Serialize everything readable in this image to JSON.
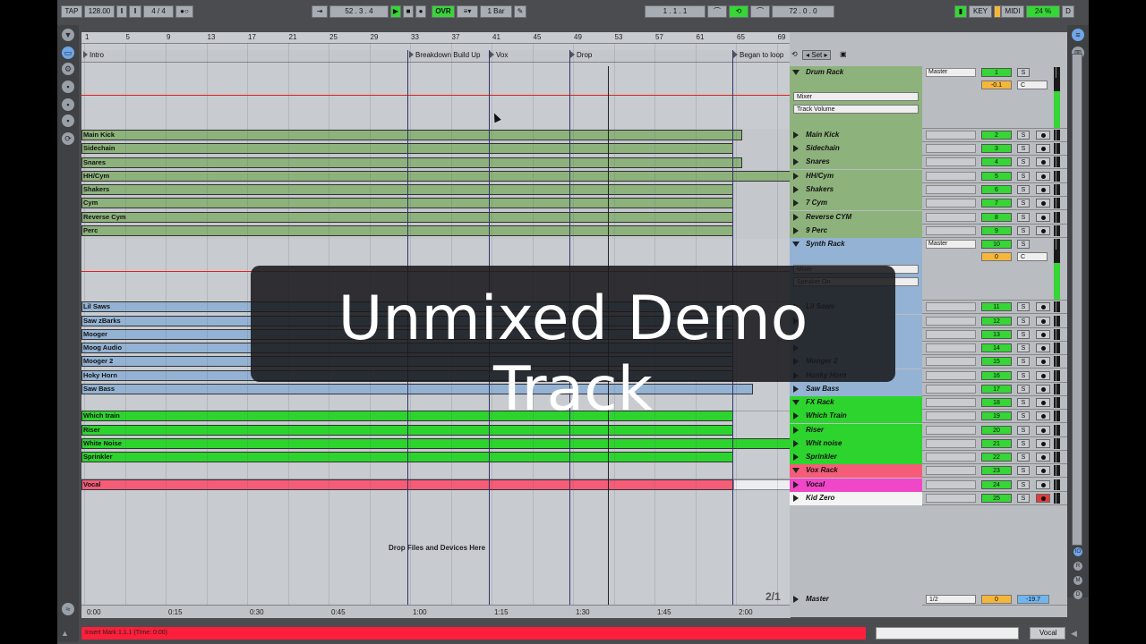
{
  "transport": {
    "tap": "TAP",
    "tempo": "128.00",
    "time_sig": "4 / 4",
    "position": "52 . 3 . 4",
    "ovr": "OVR",
    "quantize": "1 Bar",
    "loop_start": "1 . 1 . 1",
    "loop_length": "72 . 0 . 0",
    "key": "KEY",
    "midi": "MIDI",
    "cpu": "24 %",
    "d": "D"
  },
  "ruler": [
    "1",
    "5",
    "9",
    "13",
    "17",
    "21",
    "25",
    "29",
    "33",
    "37",
    "41",
    "45",
    "49",
    "53",
    "57",
    "61",
    "65",
    "69"
  ],
  "locators": [
    "Intro",
    "Breakdown Build Up",
    "Vox",
    "Drop",
    "Began to loop"
  ],
  "lane_clips": {
    "drums": [
      "Main Kick",
      "Sidechain",
      "Snares",
      "HH/Cym",
      "Shakers",
      "Cym",
      "Reverse Cym",
      "Perc"
    ],
    "synths": [
      "Lil Saws",
      "Saw zBarks",
      "Mooger",
      "Moog Audio",
      "Mooger 2",
      "Hoky Horn",
      "Saw Bass"
    ],
    "fx": [
      "Which train",
      "Riser",
      "White Noise",
      "Sprinkler"
    ],
    "vox": [
      "Vocal"
    ]
  },
  "drop_text": "Drop Files and Devices Here",
  "time_ruler": [
    "0:00",
    "0:15",
    "0:30",
    "0:45",
    "1:00",
    "1:15",
    "1:30",
    "1:45",
    "2:00"
  ],
  "position_indicator": "2/1",
  "tracks": [
    {
      "name": "Drum Rack",
      "num": "1",
      "group": true,
      "io": "Master"
    },
    {
      "name": "Main Kick",
      "num": "2"
    },
    {
      "name": "Sidechain",
      "num": "3"
    },
    {
      "name": "Snares",
      "num": "4"
    },
    {
      "name": "HH/Cym",
      "num": "5"
    },
    {
      "name": "Shakers",
      "num": "6"
    },
    {
      "name": "7 Cym",
      "num": "7"
    },
    {
      "name": "Reverse CYM",
      "num": "8"
    },
    {
      "name": "9 Perc",
      "num": "9"
    },
    {
      "name": "Synth Rack",
      "num": "10",
      "group": true,
      "io": "Master"
    },
    {
      "name": "Lil Saws",
      "num": "11"
    },
    {
      "name": "",
      "num": "12"
    },
    {
      "name": "",
      "num": "13"
    },
    {
      "name": "",
      "num": "14"
    },
    {
      "name": "Mooger 2",
      "num": "15"
    },
    {
      "name": "Honky Horn",
      "num": "16"
    },
    {
      "name": "Saw Bass",
      "num": "17"
    },
    {
      "name": "FX Rack",
      "num": "18"
    },
    {
      "name": "Which Train",
      "num": "19"
    },
    {
      "name": "Riser",
      "num": "20"
    },
    {
      "name": "Whit noise",
      "num": "21"
    },
    {
      "name": "Sprinkler",
      "num": "22"
    },
    {
      "name": "Vox Rack",
      "num": "23"
    },
    {
      "name": "Vocal",
      "num": "24"
    },
    {
      "name": "Kid Zero",
      "num": "25"
    }
  ],
  "drum_rack": {
    "mixer": "Mixer",
    "param": "Track Volume",
    "pan": "-0.1",
    "pan_right": "C"
  },
  "synth_rack": {
    "mixer": "Mixer",
    "param": "Speaker On",
    "pan": "0",
    "pan_right": "C"
  },
  "master": {
    "name": "Master",
    "io": "1/2",
    "pan": "0",
    "vol": "-19.7"
  },
  "solo": "S",
  "status": "Insert Mark 1.1.1 (Time: 0:00)",
  "bottom_track": "Vocal",
  "overlay_title": "Unmixed Demo Track",
  "colors": {
    "drum": "#8db27c",
    "synth": "#94b3d4",
    "fx": "#2dd42d",
    "vox": "#f55c78",
    "status": "#ff1f3a"
  }
}
